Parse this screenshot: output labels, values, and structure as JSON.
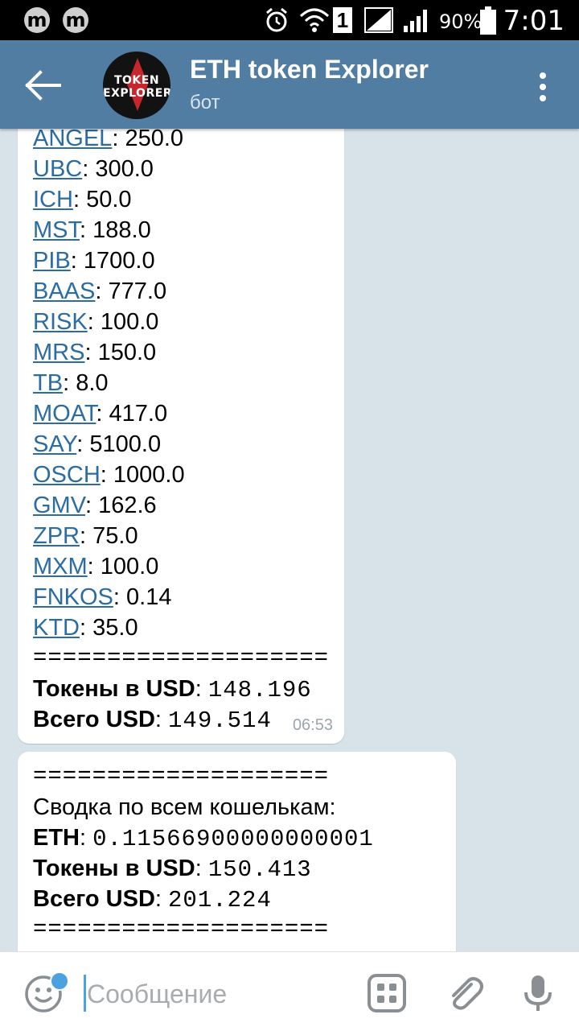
{
  "status_bar": {
    "left_icons": [
      "m",
      "m"
    ],
    "battery": "90%",
    "sim_slot": "1",
    "time": "7:01"
  },
  "header": {
    "title": "ETH token Explorer",
    "subtitle": "бот",
    "avatar_text": [
      "TOKEN",
      "EXPLORER"
    ]
  },
  "messages": [
    {
      "tokens": [
        {
          "symbol": "ANGEL",
          "value": "250.0"
        },
        {
          "symbol": "UBC",
          "value": "300.0"
        },
        {
          "symbol": "ICH",
          "value": "50.0"
        },
        {
          "symbol": "MST",
          "value": "188.0"
        },
        {
          "symbol": "PIB",
          "value": "1700.0"
        },
        {
          "symbol": "BAAS",
          "value": "777.0"
        },
        {
          "symbol": "RISK",
          "value": "100.0"
        },
        {
          "symbol": "MRS",
          "value": "150.0"
        },
        {
          "symbol": "TB",
          "value": "8.0"
        },
        {
          "symbol": "MOAT",
          "value": "417.0"
        },
        {
          "symbol": "SAY",
          "value": "5100.0"
        },
        {
          "symbol": "OSCH",
          "value": "1000.0"
        },
        {
          "symbol": "GMV",
          "value": "162.6"
        },
        {
          "symbol": "ZPR",
          "value": "75.0"
        },
        {
          "symbol": "MXM",
          "value": "100.0"
        },
        {
          "symbol": "FNKOS",
          "value": "0.14"
        },
        {
          "symbol": "KTD",
          "value": "35.0"
        }
      ],
      "separator": "====================",
      "tokens_usd_label": "Токены в USD",
      "tokens_usd_value": "148.196",
      "total_usd_label": "Всего USD",
      "total_usd_value": "149.514",
      "time": "06:53"
    },
    {
      "separator": "====================",
      "summary_text": "Сводка по всем кошелькам:",
      "eth_label": "ETH",
      "eth_value": "0.11566900000000001",
      "tokens_usd_label": "Токены в USD",
      "tokens_usd_value": "150.413",
      "total_usd_label": "Всего USD",
      "total_usd_value": "201.224",
      "separator_bottom": "===================="
    }
  ],
  "input": {
    "placeholder": "Сообщение"
  },
  "colors": {
    "app_bar": "#527da3",
    "link": "#2a6ca3",
    "chat_background": "#d7e2e9",
    "accent": "#4aa3df"
  }
}
